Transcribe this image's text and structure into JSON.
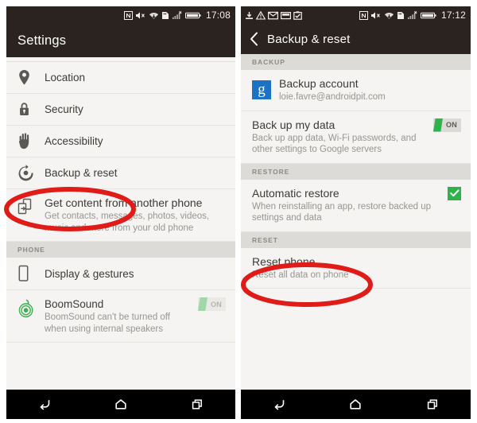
{
  "colors": {
    "accent_red": "#e01b18",
    "green": "#2eb24c",
    "bar_dark": "#2b2320",
    "panel_bg": "#f5f4f2",
    "section_bg": "#dddbd7",
    "google_blue": "#1c72c4"
  },
  "left_phone": {
    "status": {
      "time": "17:08",
      "icons_left": [],
      "icons_right": [
        "nfc-icon",
        "mute-icon",
        "wifi-download-icon",
        "sdcard-icon",
        "signal-no-service-icon",
        "battery-icon"
      ]
    },
    "title": "Settings",
    "rows": [
      {
        "icon": "location-pin-icon",
        "title": "Location",
        "sub": "",
        "control": "none"
      },
      {
        "icon": "lock-icon",
        "title": "Security",
        "sub": "",
        "control": "none"
      },
      {
        "icon": "hand-icon",
        "title": "Accessibility",
        "sub": "",
        "control": "none"
      },
      {
        "icon": "backup-reset-icon",
        "title": "Backup & reset",
        "sub": "",
        "control": "none"
      },
      {
        "icon": "transfer-phone-icon",
        "title": "Get content from another phone",
        "sub": "Get contacts, messages, photos, videos, music and more from your old phone",
        "control": "none"
      }
    ],
    "section_phone": "PHONE",
    "rows_phone": [
      {
        "icon": "phone-display-icon",
        "title": "Display & gestures",
        "sub": "",
        "control": "none"
      },
      {
        "icon": "boomsound-icon",
        "title": "BoomSound",
        "sub": "BoomSound can't be turned off when using internal speakers",
        "control": "toggle-on-disabled",
        "toggle_label": "ON"
      }
    ],
    "nav": [
      "back-icon",
      "home-icon",
      "recents-icon"
    ]
  },
  "right_phone": {
    "status": {
      "time": "17:12",
      "icons_left": [
        "download-icon",
        "warning-icon",
        "mail-icon",
        "screenshot-icon",
        "clipboard-check-icon"
      ],
      "icons_right": [
        "nfc-icon",
        "mute-icon",
        "wifi-download-icon",
        "sdcard-icon",
        "signal-no-service-icon",
        "battery-icon"
      ]
    },
    "title": "Backup & reset",
    "back_icon": "chevron-left-icon",
    "sections": [
      {
        "header": "BACKUP",
        "rows": [
          {
            "icon": "google-g-icon",
            "title": "Backup account",
            "sub": "loie.favre@androidpit.com",
            "control": "none"
          },
          {
            "icon": "none",
            "title": "Back up my data",
            "sub": "Back up app data, Wi-Fi passwords, and other settings to Google servers",
            "control": "toggle-on",
            "toggle_label": "ON"
          }
        ]
      },
      {
        "header": "RESTORE",
        "rows": [
          {
            "icon": "none",
            "title": "Automatic restore",
            "sub": "When reinstalling an app, restore backed up settings and data",
            "control": "checkbox-checked"
          }
        ]
      },
      {
        "header": "RESET",
        "rows": [
          {
            "icon": "none",
            "title": "Reset phone",
            "sub": "Reset all data on phone",
            "control": "none"
          }
        ]
      }
    ],
    "nav": [
      "back-icon",
      "home-icon",
      "recents-icon"
    ]
  },
  "annotations": [
    {
      "name": "highlight-backup-reset",
      "shape": "ellipse"
    },
    {
      "name": "highlight-reset-phone",
      "shape": "ellipse"
    }
  ]
}
